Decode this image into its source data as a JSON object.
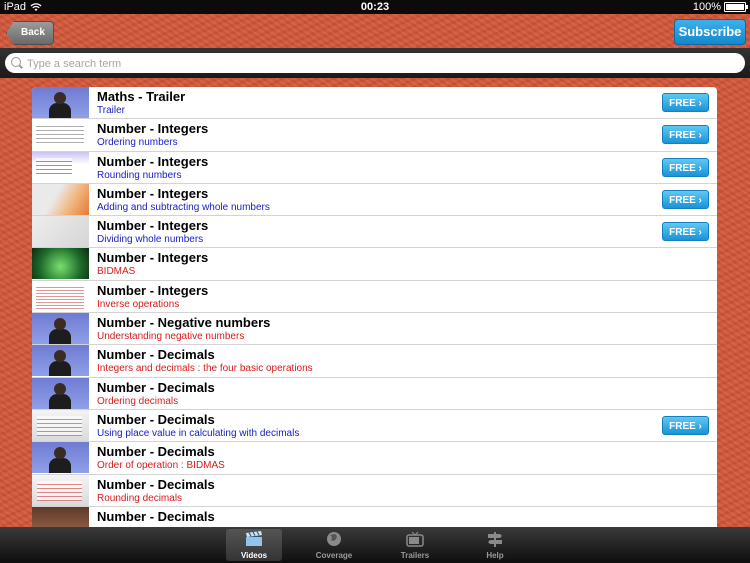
{
  "status_bar": {
    "device": "iPad",
    "time": "00:23",
    "battery": "100%"
  },
  "nav": {
    "back_label": "Back",
    "subscribe_label": "Subscribe"
  },
  "search": {
    "placeholder": "Type a search term"
  },
  "colors": {
    "free_button": "#1a93d6",
    "subtitle_blue": "#1a21c7",
    "subtitle_red": "#d91a1a",
    "background": "#d4573a"
  },
  "free_label": "FREE",
  "items": [
    {
      "title": "Maths - Trailer",
      "subtitle": "Trailer",
      "subtitle_color": "blue",
      "free": true,
      "thumb": "person"
    },
    {
      "title": "Number - Integers",
      "subtitle": "Ordering numbers",
      "subtitle_color": "blue",
      "free": true,
      "thumb": "slide"
    },
    {
      "title": "Number - Integers",
      "subtitle": "Rounding numbers",
      "subtitle_color": "blue",
      "free": true,
      "thumb": "slide2"
    },
    {
      "title": "Number - Integers",
      "subtitle": "Adding and subtracting whole numbers",
      "subtitle_color": "blue",
      "free": true,
      "thumb": "orange"
    },
    {
      "title": "Number - Integers",
      "subtitle": "Dividing whole numbers",
      "subtitle_color": "blue",
      "free": true,
      "thumb": "paper"
    },
    {
      "title": "Number - Integers",
      "subtitle": "BIDMAS",
      "subtitle_color": "red",
      "free": false,
      "thumb": "green"
    },
    {
      "title": "Number - Integers",
      "subtitle": "Inverse operations",
      "subtitle_color": "red",
      "free": false,
      "thumb": "table"
    },
    {
      "title": "Number - Negative numbers",
      "subtitle": "Understanding negative numbers",
      "subtitle_color": "red",
      "free": false,
      "thumb": "person"
    },
    {
      "title": "Number - Decimals",
      "subtitle": "Integers and decimals : the four basic operations",
      "subtitle_color": "red",
      "free": false,
      "thumb": "person"
    },
    {
      "title": "Number - Decimals",
      "subtitle": "Ordering decimals",
      "subtitle_color": "red",
      "free": false,
      "thumb": "person"
    },
    {
      "title": "Number - Decimals",
      "subtitle": "Using place value in calculating with decimals",
      "subtitle_color": "blue",
      "free": true,
      "thumb": "board"
    },
    {
      "title": "Number - Decimals",
      "subtitle": "Order of operation : BIDMAS",
      "subtitle_color": "red",
      "free": false,
      "thumb": "person"
    },
    {
      "title": "Number - Decimals",
      "subtitle": "Rounding decimals",
      "subtitle_color": "red",
      "free": false,
      "thumb": "board"
    },
    {
      "title": "Number - Decimals",
      "subtitle": "",
      "subtitle_color": "red",
      "free": false,
      "thumb": "class"
    }
  ],
  "tabs": [
    {
      "label": "Videos",
      "icon": "clapperboard-icon",
      "active": true
    },
    {
      "label": "Coverage",
      "icon": "globe-icon",
      "active": false
    },
    {
      "label": "Trailers",
      "icon": "tv-icon",
      "active": false
    },
    {
      "label": "Help",
      "icon": "signpost-icon",
      "active": false
    }
  ]
}
